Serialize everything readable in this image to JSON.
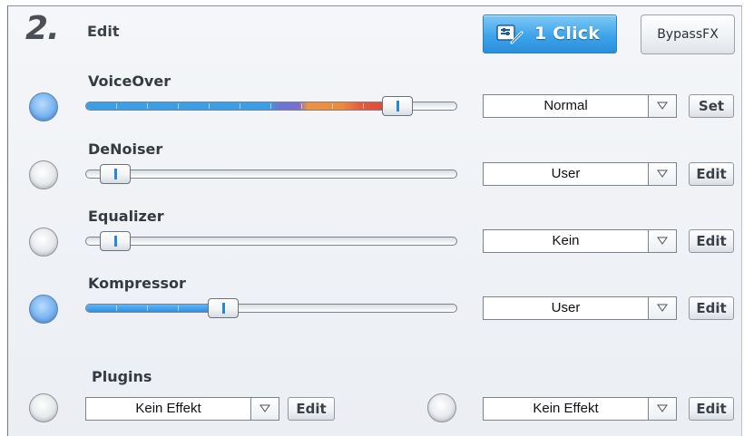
{
  "header": {
    "step_number": "2.",
    "step_title": "Edit",
    "one_click_label": "1 Click",
    "one_click_icon": "edit-wand-icon",
    "bypass_label": "BypassFX"
  },
  "colors": {
    "accent_blue": "#3ea4ea",
    "led_on": "#78b3f0",
    "panel_bg": "#eef1f5"
  },
  "effects": [
    {
      "label": "VoiceOver",
      "enabled": true,
      "level": 0.84,
      "preset": "Normal",
      "button": "Set"
    },
    {
      "label": "DeNoiser",
      "enabled": false,
      "level": 0.08,
      "preset": "User",
      "button": "Edit"
    },
    {
      "label": "Equalizer",
      "enabled": false,
      "level": 0.08,
      "preset": "Kein",
      "button": "Edit"
    },
    {
      "label": "Kompressor",
      "enabled": true,
      "level": 0.37,
      "preset": "User",
      "button": "Edit"
    }
  ],
  "plugins": {
    "label": "Plugins",
    "slots": [
      {
        "enabled": false,
        "preset": "Kein Effekt",
        "button": "Edit"
      },
      {
        "enabled": false,
        "preset": "Kein Effekt",
        "button": "Edit"
      }
    ]
  }
}
